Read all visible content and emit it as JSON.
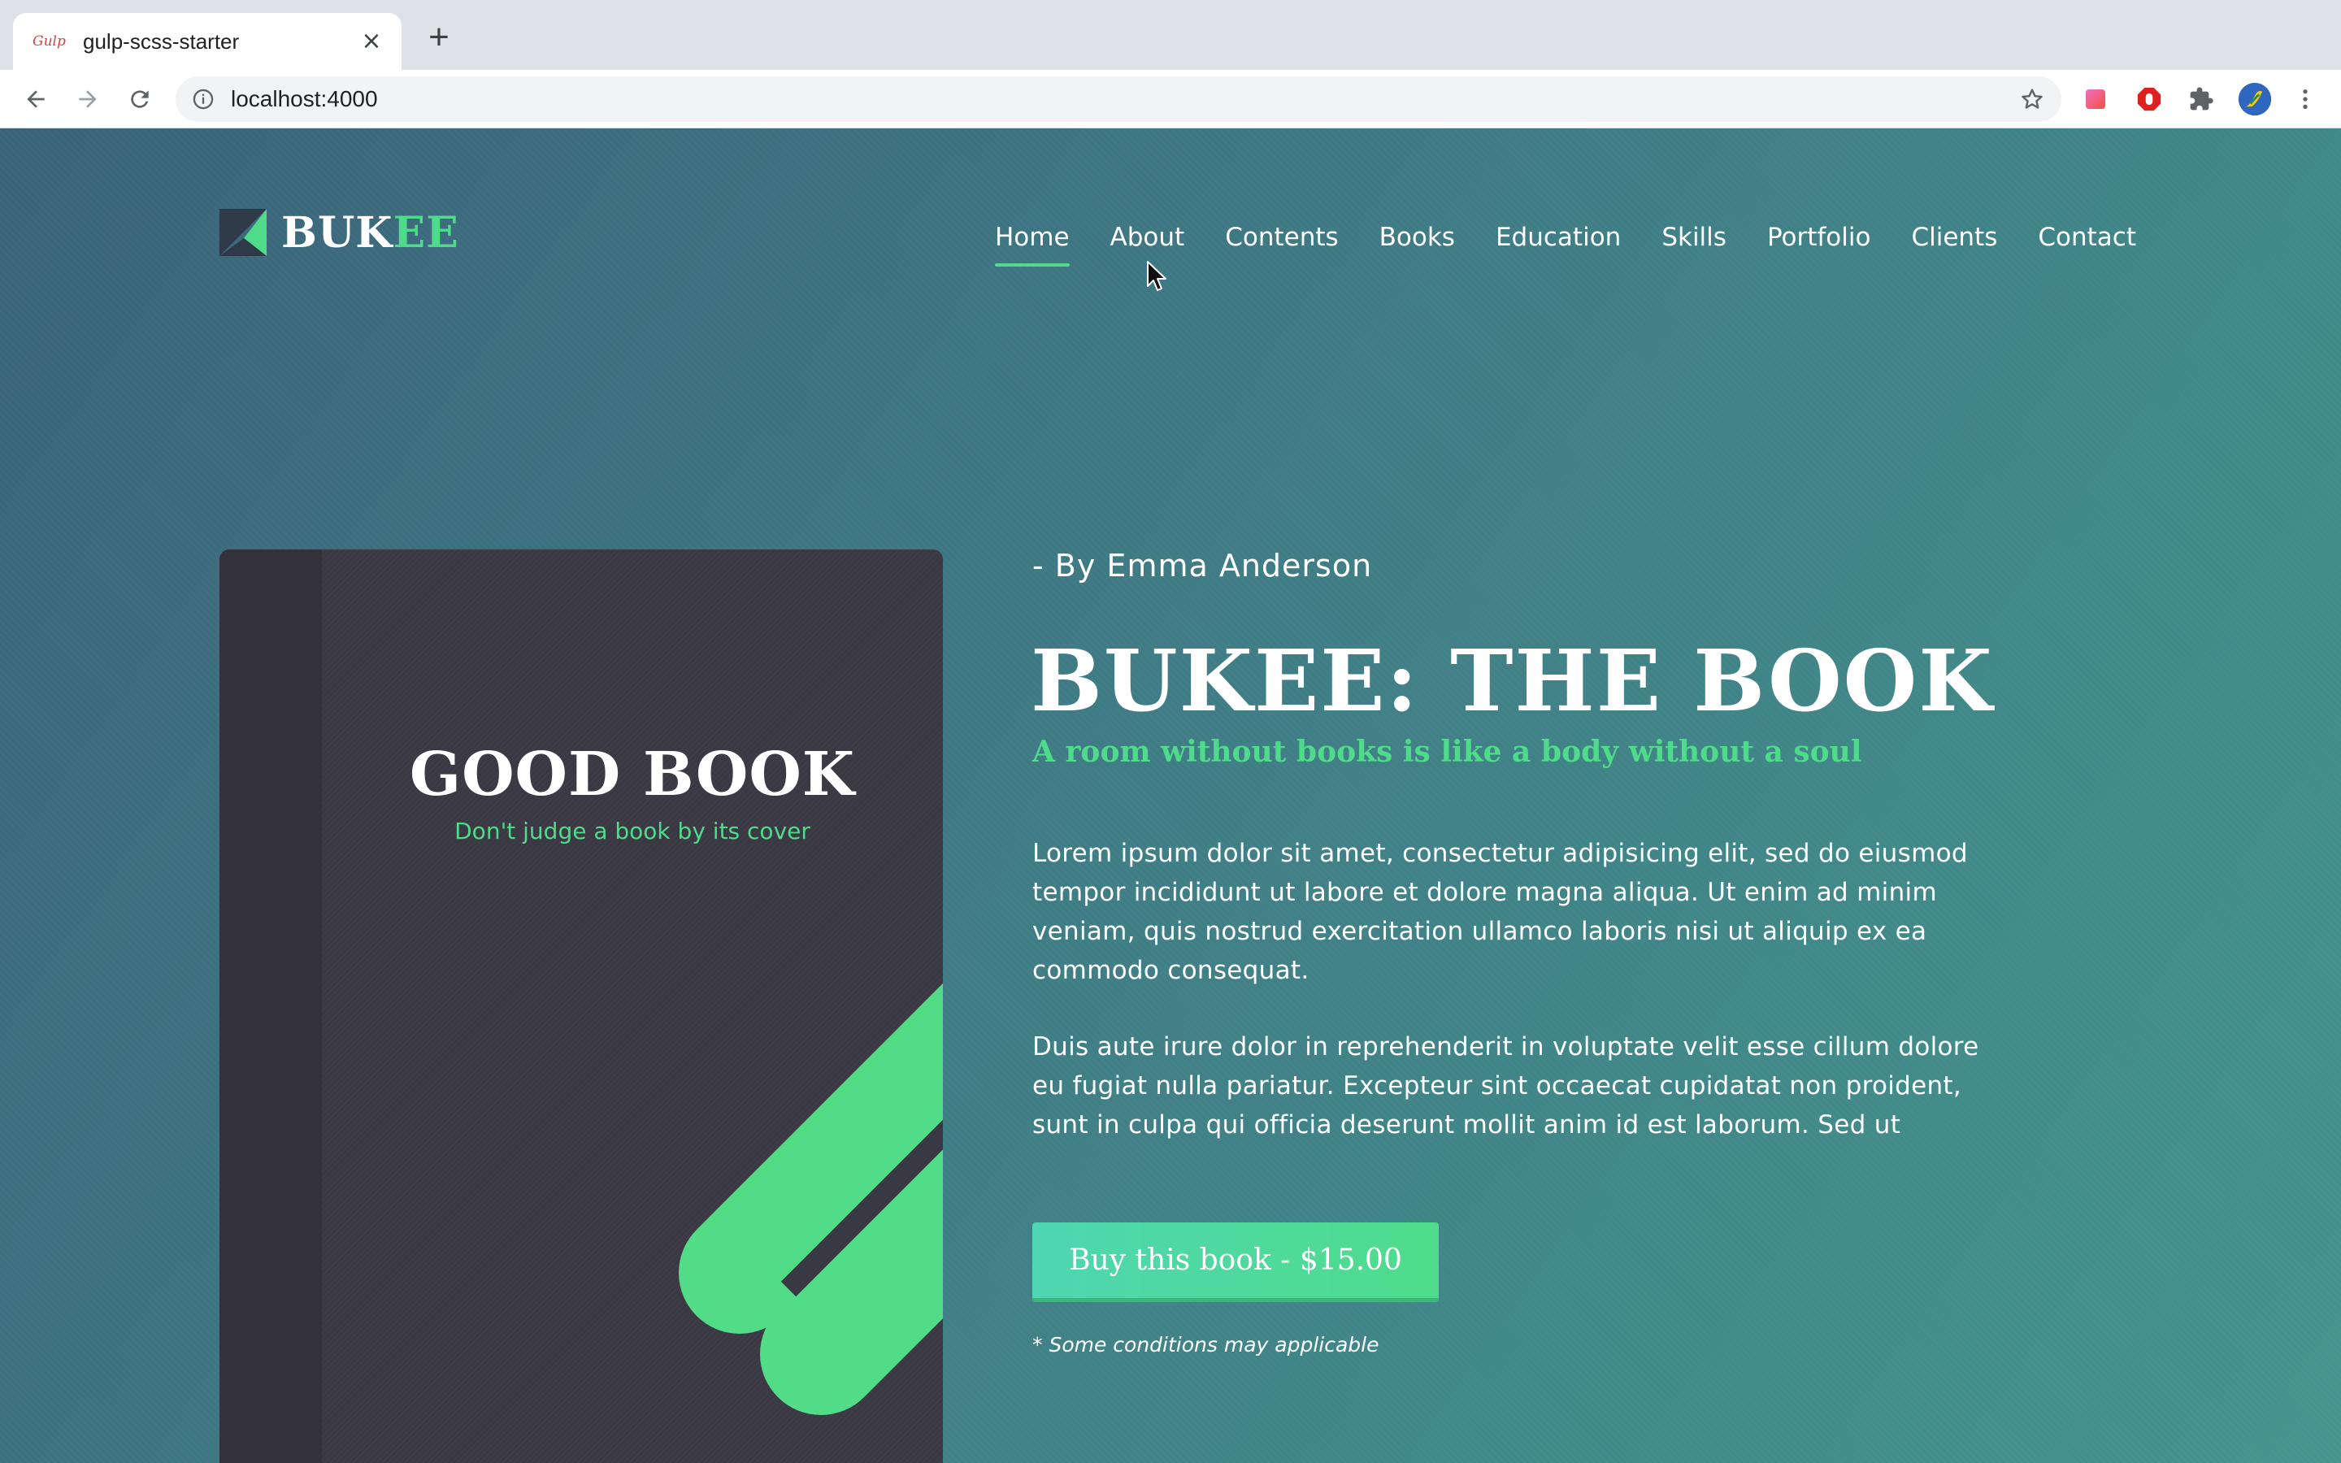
{
  "browser": {
    "tab_title": "gulp-scss-starter",
    "tab_favicon": "Gulp",
    "tab_close": "×",
    "new_tab": "+",
    "url": "localhost:4000",
    "icons": [
      "back-icon",
      "forward-icon",
      "reload-icon",
      "info-icon",
      "star-icon",
      "extension-gradient-icon",
      "adblock-icon",
      "puzzle-icon",
      "profile-avatar",
      "more-vert-icon"
    ]
  },
  "site": {
    "logo_part1": "BUK",
    "logo_part2": "EE",
    "nav": [
      "Home",
      "About",
      "Contents",
      "Books",
      "Education",
      "Skills",
      "Portfolio",
      "Clients",
      "Contact"
    ],
    "active_nav": "Home",
    "accent_color": "#4fdc8a"
  },
  "book": {
    "title": "GOOD BOOK",
    "subtitle": "Don't judge a book by its cover"
  },
  "hero": {
    "byline": "- By Emma Anderson",
    "title": "BUKEE: THE BOOK",
    "quote": "A room without books is like a body without a soul",
    "para1": "Lorem ipsum dolor sit amet, consectetur adipisicing elit, sed do eiusmod tempor incididunt ut labore et dolore magna aliqua. Ut enim ad minim veniam, quis nostrud exercitation ullamco laboris nisi ut aliquip ex ea commodo consequat.",
    "para2": "Duis aute irure dolor in reprehenderit in voluptate velit esse cillum dolore eu fugiat nulla pariatur. Excepteur sint occaecat cupidatat non proident, sunt in culpa qui officia deserunt mollit anim id est laborum. Sed ut",
    "buy_label": "Buy this book - $15.00",
    "note": "* Some conditions may applicable"
  }
}
